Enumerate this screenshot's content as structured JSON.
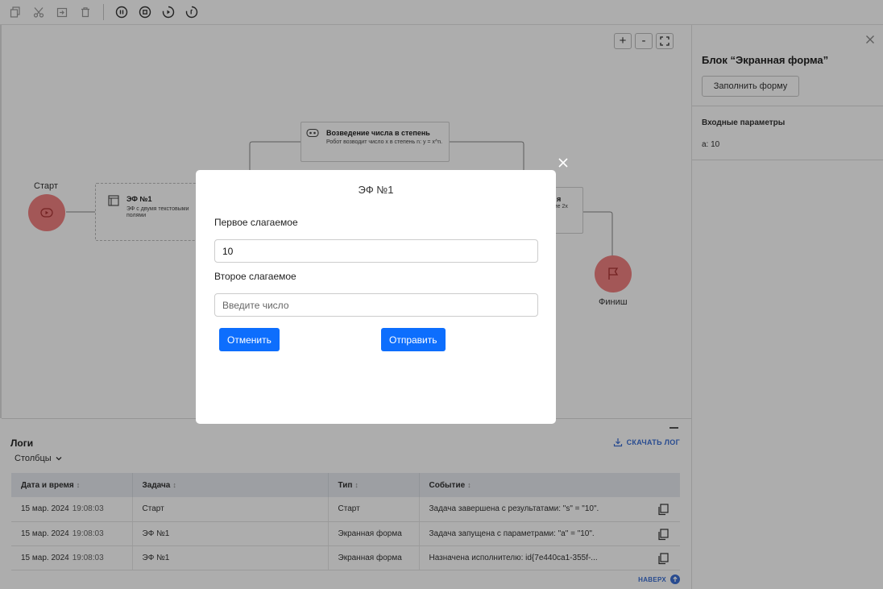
{
  "toolbar": {
    "icons": [
      "copy-icon",
      "cut-icon",
      "paste-icon",
      "delete-icon",
      "pause-icon",
      "stop-icon",
      "step-icon",
      "restart-icon"
    ]
  },
  "canvas": {
    "zoom_in": "+",
    "zoom_out": "-",
    "start_label": "Старт",
    "finish_label": "Финиш",
    "task_form": {
      "title": "ЭФ №1",
      "desc": "ЭФ с двумя текстовыми полями"
    },
    "task_power": {
      "title": "Возведение числа в степень",
      "desc": "Робот возводит число x в степень n: y = x^n."
    },
    "task_partial_title": "я",
    "task_partial_desc": "ение 2x"
  },
  "panel": {
    "title": "Блок “Экранная форма”",
    "fill_button": "Заполнить форму",
    "inputs_header": "Входные параметры",
    "param": "a: 10"
  },
  "logs": {
    "title": "Логи",
    "columns_button": "Столбцы",
    "download": "СКАЧАТЬ ЛОГ",
    "to_top": "НАВЕРХ",
    "headers": [
      "Дата и время",
      "Задача",
      "Тип",
      "Событие"
    ],
    "rows": [
      {
        "date": "15 мар. 2024",
        "time": "19:08:03",
        "task": "Старт",
        "type": "Старт",
        "event": "Задача завершена с результатами: \"s\" = \"10\"."
      },
      {
        "date": "15 мар. 2024",
        "time": "19:08:03",
        "task": "ЭФ №1",
        "type": "Экранная форма",
        "event": "Задача запущена с параметрами: \"a\" = \"10\"."
      },
      {
        "date": "15 мар. 2024",
        "time": "19:08:03",
        "task": "ЭФ №1",
        "type": "Экранная форма",
        "event": "Назначена исполнителю: id{7e440ca1-355f-..."
      }
    ]
  },
  "modal": {
    "title": "ЭФ №1",
    "field1_label": "Первое слагаемое",
    "field1_value": "10",
    "field2_label": "Второе слагаемое",
    "field2_placeholder": "Введите число",
    "cancel": "Отменить",
    "submit": "Отправить"
  },
  "colors": {
    "primary": "#0d6efd",
    "node": "#f08080",
    "link": "#3b6fd4"
  }
}
